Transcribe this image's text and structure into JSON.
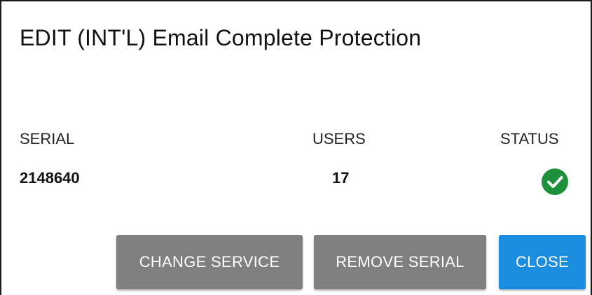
{
  "dialog": {
    "title": "EDIT (INT'L) Email Complete Protection"
  },
  "table": {
    "headers": {
      "serial": "SERIAL",
      "users": "USERS",
      "status": "STATUS"
    },
    "rows": [
      {
        "serial": "2148640",
        "users": "17",
        "status_icon": "check-circle-icon",
        "status_color": "#1e8f3a"
      }
    ]
  },
  "actions": {
    "change_service": "CHANGE SERVICE",
    "remove_serial": "REMOVE SERIAL",
    "close": "CLOSE"
  },
  "colors": {
    "secondary_button": "#808080",
    "primary_button": "#1d8de0",
    "status_ok": "#1e8f3a"
  }
}
